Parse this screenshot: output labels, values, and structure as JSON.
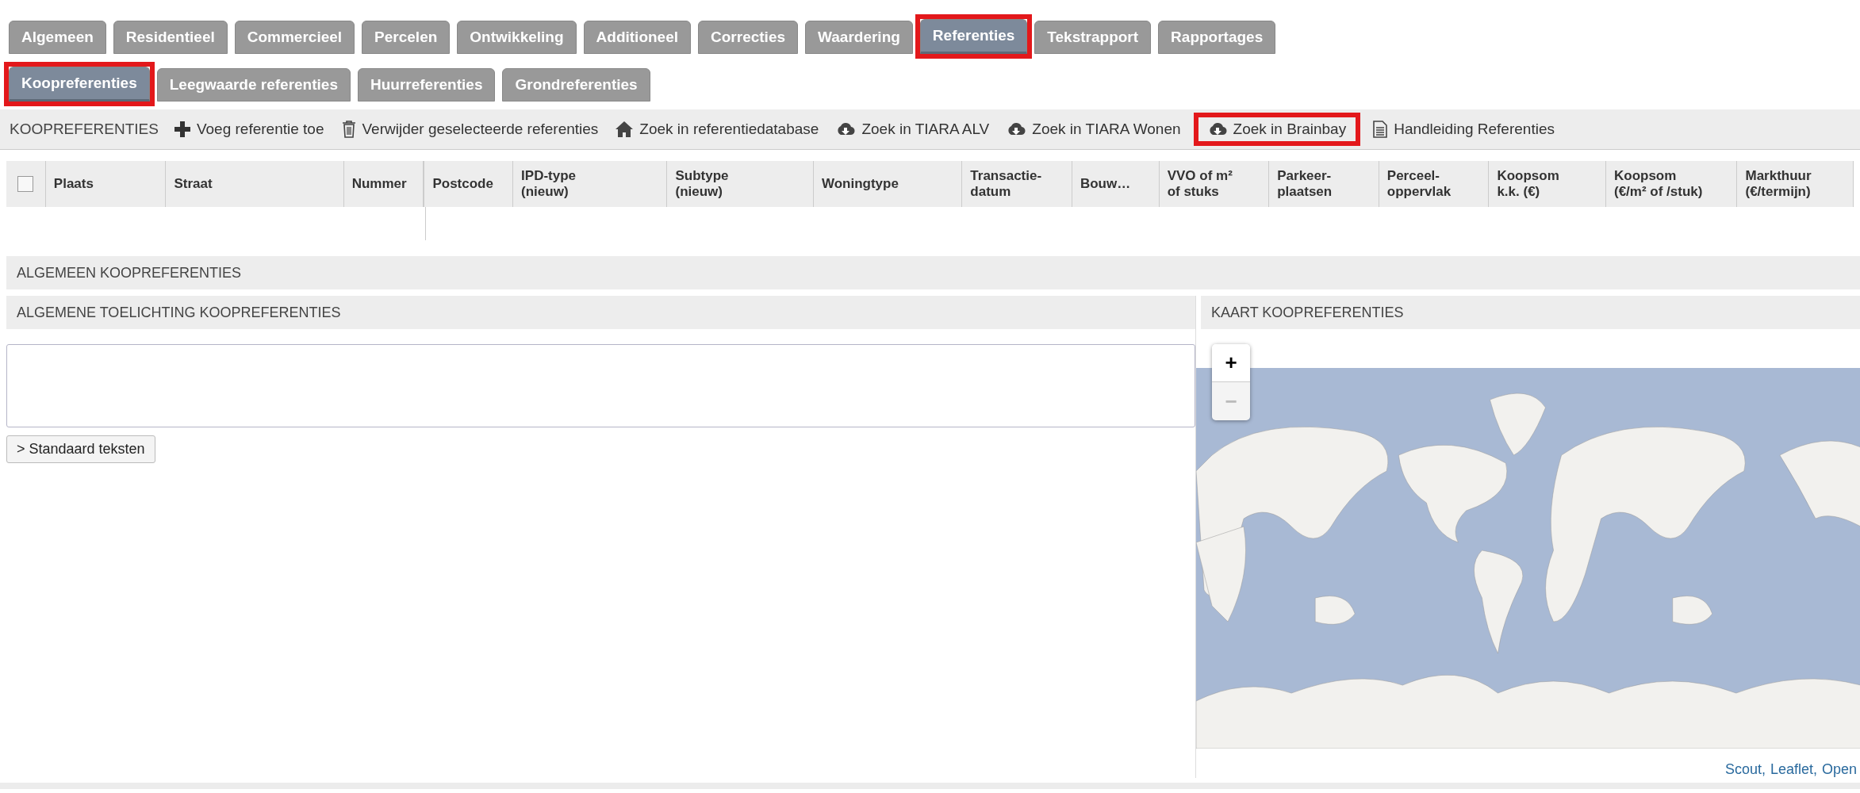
{
  "tabs": [
    {
      "label": "Algemeen",
      "selected": false,
      "highlighted": false
    },
    {
      "label": "Residentieel",
      "selected": false,
      "highlighted": false
    },
    {
      "label": "Commercieel",
      "selected": false,
      "highlighted": false
    },
    {
      "label": "Percelen",
      "selected": false,
      "highlighted": false
    },
    {
      "label": "Ontwikkeling",
      "selected": false,
      "highlighted": false
    },
    {
      "label": "Additioneel",
      "selected": false,
      "highlighted": false
    },
    {
      "label": "Correcties",
      "selected": false,
      "highlighted": false
    },
    {
      "label": "Waardering",
      "selected": false,
      "highlighted": false
    },
    {
      "label": "Referenties",
      "selected": true,
      "highlighted": true
    },
    {
      "label": "Tekstrapport",
      "selected": false,
      "highlighted": false
    },
    {
      "label": "Rapportages",
      "selected": false,
      "highlighted": false
    }
  ],
  "subtabs": [
    {
      "label": "Koopreferenties",
      "selected": true,
      "highlighted": true
    },
    {
      "label": "Leegwaarde referenties",
      "selected": false,
      "highlighted": false
    },
    {
      "label": "Huurreferenties",
      "selected": false,
      "highlighted": false
    },
    {
      "label": "Grondreferenties",
      "selected": false,
      "highlighted": false
    }
  ],
  "toolbar": {
    "title": "KOOPREFERENTIES",
    "actions": [
      {
        "label": "Voeg referentie toe",
        "kind": "add",
        "highlighted": false
      },
      {
        "label": "Verwijder geselecteerde referenties",
        "kind": "delete",
        "highlighted": false
      },
      {
        "label": "Zoek in referentiedatabase",
        "kind": "database",
        "highlighted": false
      },
      {
        "label": "Zoek in TIARA ALV",
        "kind": "download",
        "highlighted": false
      },
      {
        "label": "Zoek in TIARA Wonen",
        "kind": "download",
        "highlighted": false
      },
      {
        "label": "Zoek in Brainbay",
        "kind": "download",
        "highlighted": true
      },
      {
        "label": "Handleiding Referenties",
        "kind": "manual",
        "highlighted": false
      }
    ]
  },
  "table": {
    "select_all_checked": false,
    "columns": [
      "Plaats",
      "Straat",
      "Nummer",
      "Postcode",
      "IPD-type\n(nieuw)",
      "Subtype\n(nieuw)",
      "Woningtype",
      "Transactie-\ndatum",
      "Bouw…",
      "VVO of m²\nof stuks",
      "Parkeer-\nplaatsen",
      "Perceel-\noppervlak",
      "Koopsom\nk.k. (€)",
      "Koopsom\n(€/m² of /stuk)",
      "Markthuur\n(€/termijn)"
    ]
  },
  "section_title": "ALGEMEEN KOOPREFERENTIES",
  "notes": {
    "title": "ALGEMENE TOELICHTING KOOPREFERENTIES",
    "button": "> Standaard teksten"
  },
  "map": {
    "title": "KAART KOOPREFERENTIES",
    "zoom_in": "+",
    "zoom_out": "−",
    "attribution": [
      "Scout,",
      "Leaflet,",
      "Open"
    ]
  }
}
